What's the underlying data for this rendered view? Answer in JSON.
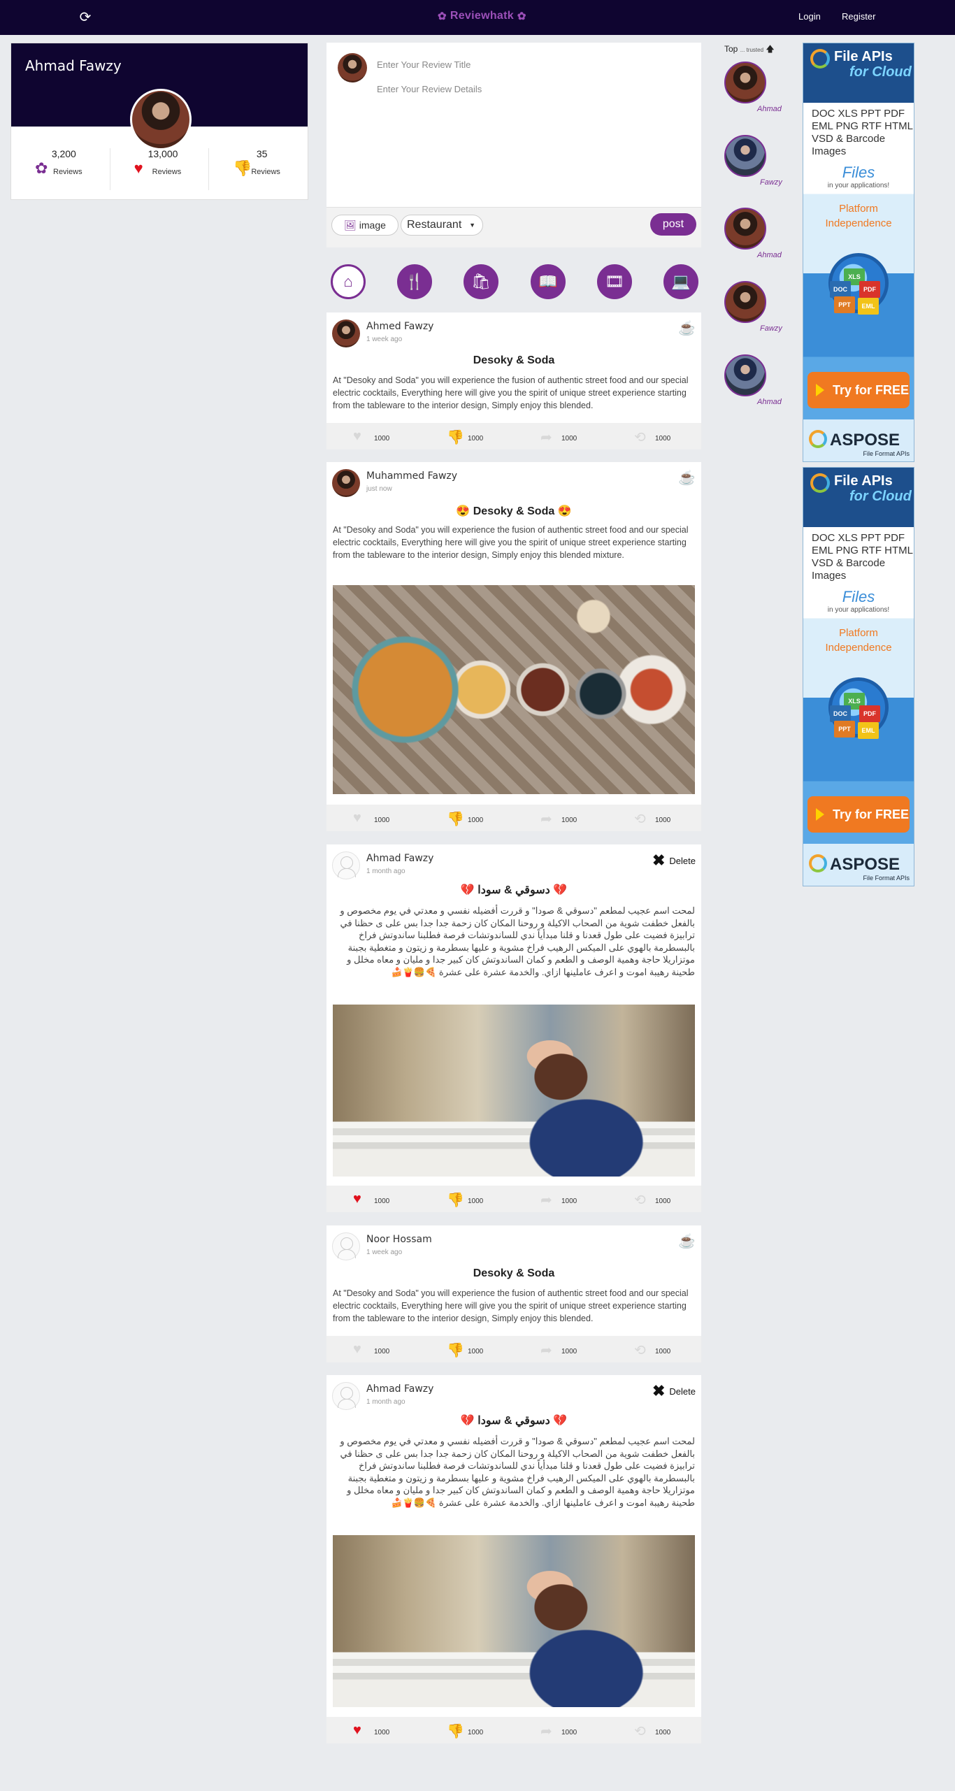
{
  "nav": {
    "brand": "Reviewhatk",
    "login": "Login",
    "register": "Register",
    "refresh_icon": "refresh-icon"
  },
  "profile": {
    "name": "Ahmad Fawzy",
    "stats": [
      {
        "value": "3,200",
        "label": "Reviews",
        "icon": "flower-icon"
      },
      {
        "value": "13,000",
        "label": "Reviews",
        "icon": "heart-icon"
      },
      {
        "value": "35",
        "label": "Reviews",
        "icon": "thumbs-down-icon"
      }
    ]
  },
  "composer": {
    "title_placeholder": "Enter Your Review Title",
    "details_placeholder": "Enter Your Review Details",
    "image_label": "image",
    "category_selected": "Restaurant",
    "post_label": "post"
  },
  "categories": [
    "home-icon",
    "restaurant-icon",
    "shopping-icon",
    "books-icon",
    "movies-icon",
    "laptop-icon"
  ],
  "posts": [
    {
      "author": "Ahmed Fawzy",
      "time": "1 week ago",
      "title": "Desoky & Soda",
      "body": "At \"Desoky and Soda\" you will experience the fusion of authentic street food and our special electric cocktails, Everything here will give you the spirit of unique street experience starting from the tableware to the interior design, Simply enjoy this blended.",
      "counts": [
        "1000",
        "1000",
        "1000",
        "1000"
      ]
    },
    {
      "author": "Muhammed Fawzy",
      "time": "just now",
      "title": "Desoky & Soda",
      "title_emoji": "😍",
      "body": "At \"Desoky and Soda\" you will experience the fusion of authentic street food and our special electric cocktails, Everything here will give you the spirit of unique street experience starting from the tableware to the interior design, Simply enjoy this blended mixture.",
      "counts": [
        "1000",
        "1000",
        "1000",
        "1000"
      ]
    },
    {
      "author": "Ahmad Fawzy",
      "time": "1 month ago",
      "delete_label": "Delete",
      "title": "دسوقي & سودا",
      "title_emoji": "💔",
      "body": "لمحت اسم عجيب لمطعم \"دسوقي & صودا\" و قررت أفضيله نفسي و معدتي في يوم مخصوص و بالفعل خطفت شوية من الصحاب الاكيلة و روحنا المكان كان زحمة جدا جدا بس علی ی حظنا في ترابيزة فضيت علی طول قعدنا و قلنا مبدأياً ندي للساندوتشات فرصة فطلبنا ساندوتش فراخ بالبسطرمة بالهوي علی الميكس الرهيب فراخ مشوية و عليها بسطرمة و زيتون و متغطية بجبنة موتزاريلا حاجة وهمية الوصف و الطعم و كمان الساندوتش كان كبير جدا و مليان و معاه مخلل و طحينة رهيبة اموت و اعرف عاملينها ازاي. والخدمة عشرة علی عشرة 🍕🍔🍟🍰",
      "counts": [
        "1000",
        "1000",
        "1000",
        "1000"
      ]
    },
    {
      "author": "Noor Hossam",
      "time": "1 week ago",
      "title": "Desoky & Soda",
      "body": "At \"Desoky and Soda\" you will experience the fusion of authentic street food and our special electric cocktails, Everything here will give you the spirit of unique street experience starting from the tableware to the interior design, Simply enjoy this blended.",
      "counts": [
        "1000",
        "1000",
        "1000",
        "1000"
      ]
    },
    {
      "author": "Ahmad Fawzy",
      "time": "1 month ago",
      "delete_label": "Delete",
      "title": "دسوقي & سودا",
      "title_emoji": "💔",
      "body": "لمحت اسم عجيب لمطعم \"دسوقي & صودا\" و قررت أفضيله نفسي و معدتي في يوم مخصوص و بالفعل خطفت شوية من الصحاب الاكيلة و روحنا المكان كان زحمة جدا جدا بس علی ی حظنا في ترابيزة فضيت علی طول قعدنا و قلنا مبدأياً ندي للساندوتشات فرصة فطلبنا ساندوتش فراخ بالبسطرمة بالهوي علی الميكس الرهيب فراخ مشوية و عليها بسطرمة و زيتون و متغطية بجبنة موتزاريلا حاجة وهمية الوصف و الطعم و كمان الساندوتش كان كبير جدا و مليان و معاه مخلل و طحينة رهيبة اموت و اعرف عاملينها ازاي. والخدمة عشرة علی عشرة 🍕🍔🍟🍰",
      "counts": [
        "1000",
        "1000",
        "1000",
        "1000"
      ]
    }
  ],
  "top_trusted": {
    "label": "Top",
    "sub": "... trusted",
    "users": [
      "Ahmad",
      "Fawzy",
      "Ahmad",
      "Fawzy",
      "Ahmad"
    ]
  },
  "ads": {
    "headline_1": "File APIs",
    "headline_2": "for Cloud",
    "formats": "DOC  XLS  PPT PDF  EML  PNG RTF  HTML  VSD &  Barcode Images",
    "files": "Files",
    "sub": "in your applications!",
    "platform_1": "Platform",
    "platform_2": "Independence",
    "cta": "Try for FREE",
    "brand": "ASPOSE",
    "brand_sub": "File Format APIs",
    "doc_labels": [
      "XLS",
      "DOC",
      "PDF",
      "PPT",
      "EML"
    ]
  },
  "colors": {
    "nav_bg": "#0f0530",
    "accent": "#7a2e92",
    "like_red": "#e0121e",
    "page_bg": "#e9ebee"
  }
}
